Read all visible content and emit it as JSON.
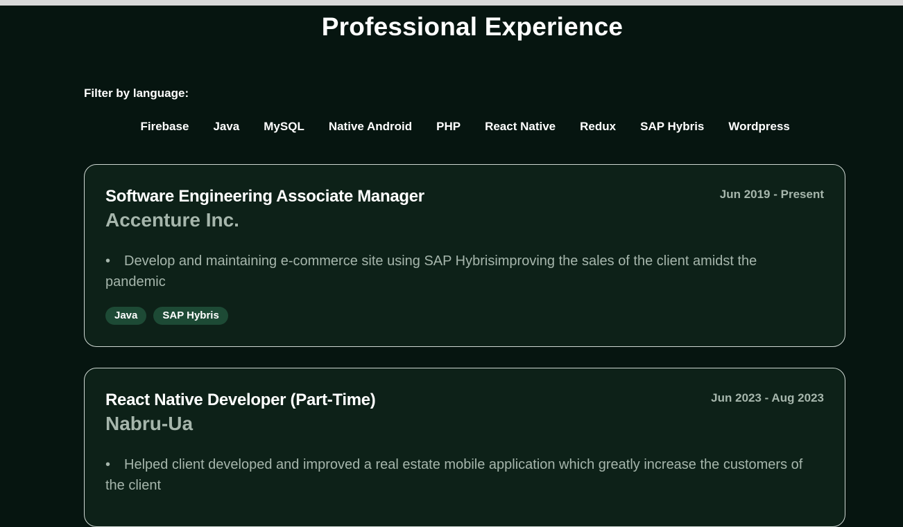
{
  "page": {
    "title": "Professional Experience"
  },
  "filter": {
    "label": "Filter by language:",
    "options": [
      "Firebase",
      "Java",
      "MySQL",
      "Native Android",
      "PHP",
      "React Native",
      "Redux",
      "SAP Hybris",
      "Wordpress"
    ]
  },
  "experiences": [
    {
      "title": "Software Engineering Associate Manager",
      "company": "Accenture Inc.",
      "dates": "Jun 2019 - Present",
      "bullets": [
        "Develop and maintaining e-commerce site using SAP Hybrisimproving the sales of the client amidst the pandemic"
      ],
      "tags": [
        "Java",
        "SAP Hybris"
      ]
    },
    {
      "title": "React Native Developer (Part-Time)",
      "company": "Nabru-Ua",
      "dates": "Jun 2023 - Aug 2023",
      "bullets": [
        "Helped client developed and improved a real estate mobile application which greatly increase the customers of the client"
      ],
      "tags": []
    }
  ],
  "colors": {
    "background": "#061510",
    "card_background": "#0d2118",
    "card_border": "#cfd8d3",
    "muted_text": "#a6b6ac",
    "tag_background": "#1d4a35"
  }
}
